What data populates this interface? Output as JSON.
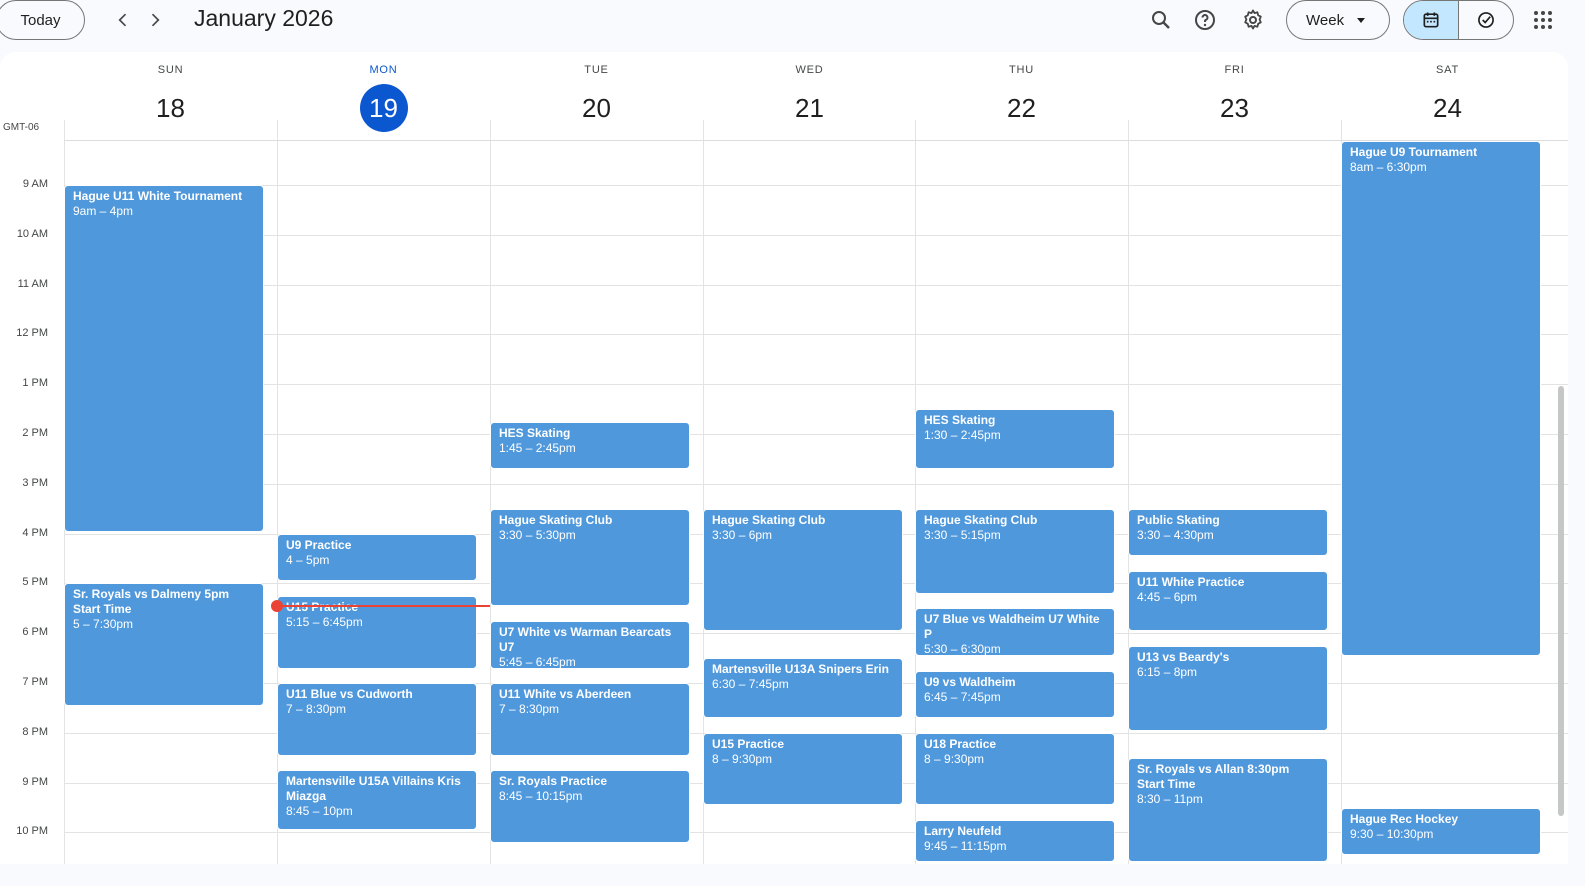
{
  "toolbar": {
    "today_label": "Today",
    "month_title": "January 2026",
    "view_label": "Week"
  },
  "timezone": "GMT-06",
  "days": [
    {
      "dow": "SUN",
      "num": "18",
      "today": false
    },
    {
      "dow": "MON",
      "num": "19",
      "today": true
    },
    {
      "dow": "TUE",
      "num": "20",
      "today": false
    },
    {
      "dow": "WED",
      "num": "21",
      "today": false
    },
    {
      "dow": "THU",
      "num": "22",
      "today": false
    },
    {
      "dow": "FRI",
      "num": "23",
      "today": false
    },
    {
      "dow": "SAT",
      "num": "24",
      "today": false
    }
  ],
  "hours": [
    "9 AM",
    "10 AM",
    "11 AM",
    "12 PM",
    "1 PM",
    "2 PM",
    "3 PM",
    "4 PM",
    "5 PM",
    "6 PM",
    "7 PM",
    "8 PM",
    "9 PM",
    "10 PM"
  ],
  "events": [
    {
      "day": 0,
      "start": 9.0,
      "end": 16.0,
      "title": "Hague U11 White Tournament",
      "time": "9am – 4pm"
    },
    {
      "day": 0,
      "start": 17.0,
      "end": 19.5,
      "title": "Sr. Royals vs Dalmeny 5pm Start Time",
      "time": "5 – 7:30pm"
    },
    {
      "day": 1,
      "start": 16.0,
      "end": 17.0,
      "title": "U9 Practice",
      "time": "4 – 5pm"
    },
    {
      "day": 1,
      "start": 17.25,
      "end": 18.75,
      "title": "U15 Practice",
      "time": "5:15 – 6:45pm"
    },
    {
      "day": 1,
      "start": 19.0,
      "end": 20.5,
      "title": "U11 Blue vs Cudworth",
      "time": "7 – 8:30pm"
    },
    {
      "day": 1,
      "start": 20.75,
      "end": 22.0,
      "title": "Martensville U15A Villains Kris Miazga",
      "time": "8:45 – 10pm"
    },
    {
      "day": 2,
      "start": 13.75,
      "end": 14.75,
      "title": "HES Skating",
      "time": "1:45 – 2:45pm"
    },
    {
      "day": 2,
      "start": 15.5,
      "end": 17.5,
      "title": "Hague Skating Club",
      "time": "3:30 – 5:30pm"
    },
    {
      "day": 2,
      "start": 17.75,
      "end": 18.75,
      "title": "U7 White vs Warman Bearcats U7",
      "time": "5:45 – 6:45pm"
    },
    {
      "day": 2,
      "start": 19.0,
      "end": 20.5,
      "title": "U11 White vs Aberdeen",
      "time": "7 – 8:30pm"
    },
    {
      "day": 2,
      "start": 20.75,
      "end": 22.25,
      "title": "Sr. Royals Practice",
      "time": "8:45 – 10:15pm"
    },
    {
      "day": 3,
      "start": 15.5,
      "end": 18.0,
      "title": "Hague Skating Club",
      "time": "3:30 – 6pm"
    },
    {
      "day": 3,
      "start": 18.5,
      "end": 19.75,
      "title": "Martensville U13A Snipers Erin",
      "time": "6:30 – 7:45pm"
    },
    {
      "day": 3,
      "start": 20.0,
      "end": 21.5,
      "title": "U15 Practice",
      "time": "8 – 9:30pm"
    },
    {
      "day": 4,
      "start": 13.5,
      "end": 14.75,
      "title": "HES Skating",
      "time": "1:30 – 2:45pm"
    },
    {
      "day": 4,
      "start": 15.5,
      "end": 17.25,
      "title": "Hague Skating Club",
      "time": "3:30 – 5:15pm"
    },
    {
      "day": 4,
      "start": 17.5,
      "end": 18.5,
      "title": "U7 Blue vs Waldheim U7 White P",
      "time": "5:30 – 6:30pm"
    },
    {
      "day": 4,
      "start": 18.75,
      "end": 19.75,
      "title": "U9 vs Waldheim",
      "time": "6:45 – 7:45pm"
    },
    {
      "day": 4,
      "start": 20.0,
      "end": 21.5,
      "title": "U18 Practice",
      "time": "8 – 9:30pm"
    },
    {
      "day": 4,
      "start": 21.75,
      "end": 23.25,
      "title": "Larry Neufeld",
      "time": "9:45 – 11:15pm"
    },
    {
      "day": 5,
      "start": 15.5,
      "end": 16.5,
      "title": "Public Skating",
      "time": "3:30 – 4:30pm"
    },
    {
      "day": 5,
      "start": 16.75,
      "end": 18.0,
      "title": "U11 White Practice",
      "time": "4:45 – 6pm"
    },
    {
      "day": 5,
      "start": 18.25,
      "end": 20.0,
      "title": "U13 vs Beardy's",
      "time": "6:15 – 8pm"
    },
    {
      "day": 5,
      "start": 20.5,
      "end": 23.0,
      "title": "Sr. Royals vs Allan 8:30pm Start Time",
      "time": "8:30 – 11pm"
    },
    {
      "day": 6,
      "start": 8.0,
      "end": 18.5,
      "title": "Hague U9 Tournament",
      "time": "8am – 6:30pm"
    },
    {
      "day": 6,
      "start": 21.5,
      "end": 22.5,
      "title": "Hague Rec Hockey",
      "time": "9:30 – 10:30pm"
    }
  ],
  "now": {
    "day": 1,
    "hour": 17.45
  },
  "colors": {
    "event": "#4f98dc",
    "today": "#0b57d0",
    "now_line": "#ea4335"
  }
}
